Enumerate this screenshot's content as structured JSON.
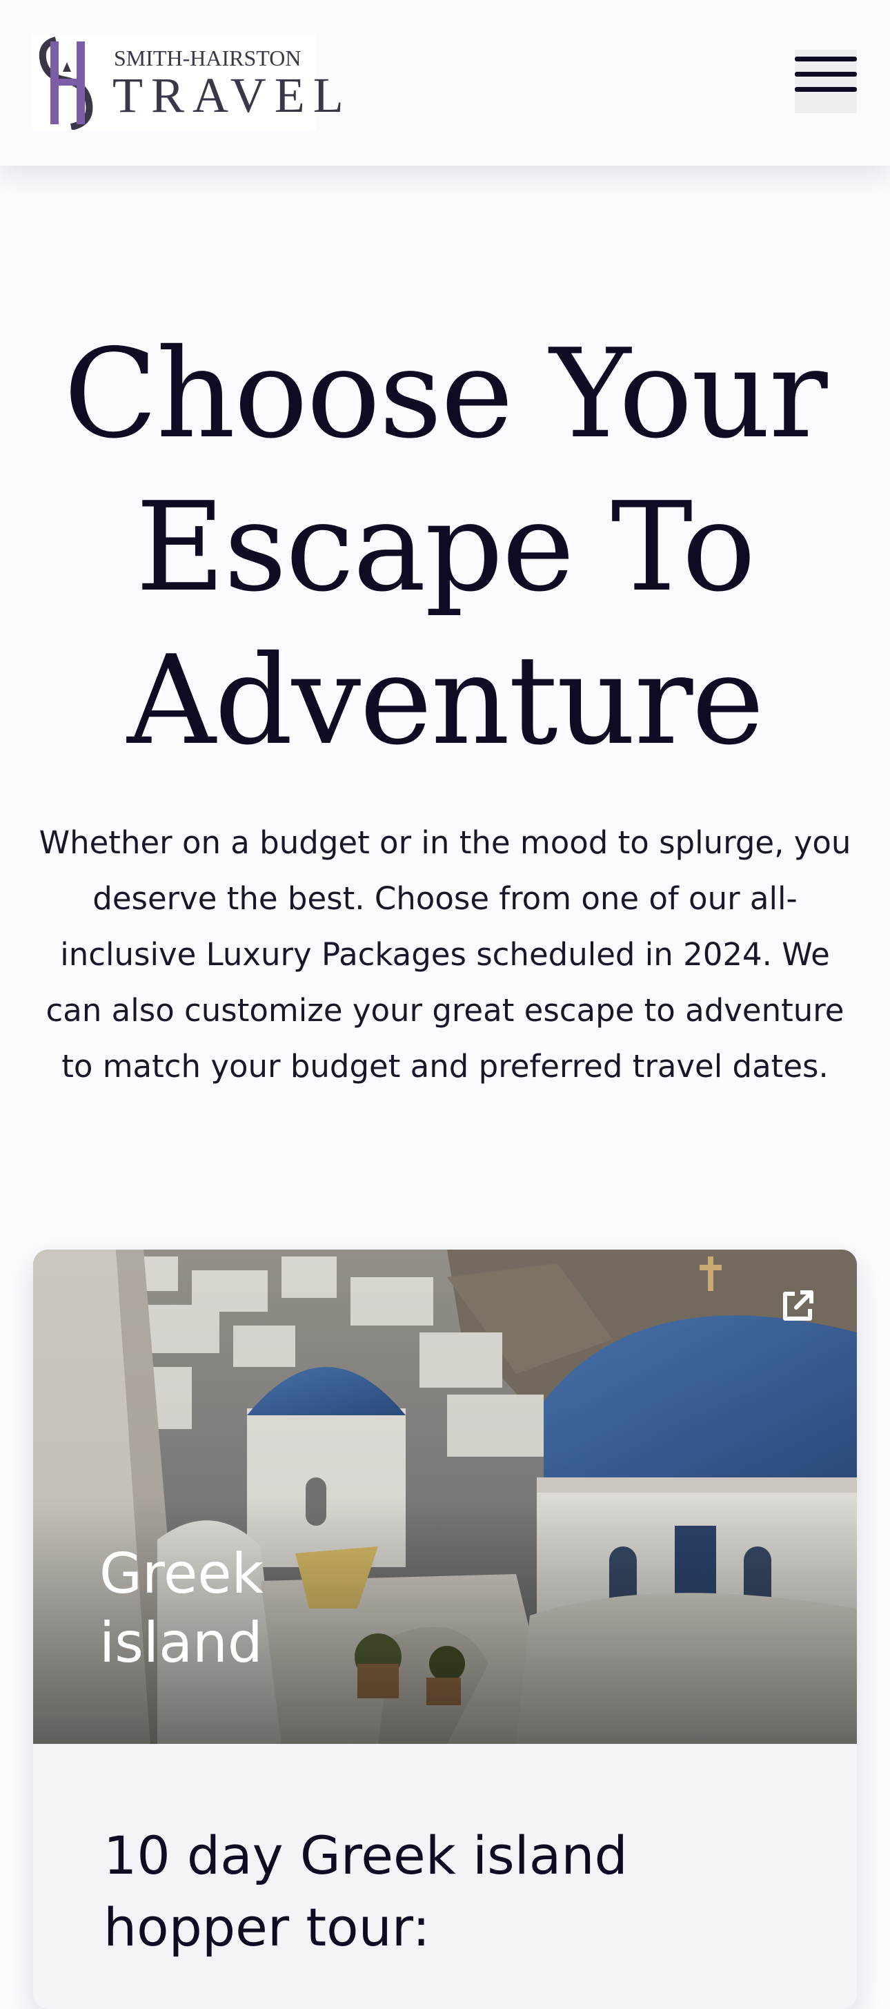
{
  "header": {
    "logo": {
      "line1": "SMITH-HAIRSTON",
      "line2": "TRAVEL",
      "monogram": "SH"
    },
    "menu_icon": "hamburger-menu-icon"
  },
  "hero": {
    "title_lines": [
      "Choose Your",
      "Escape To",
      "Adventure"
    ],
    "description": "Whether on a budget or in the mood to splurge, you deserve the best. Choose from one of our all-inclusive Luxury Packages scheduled in 2024. We can also customize your great escape to adventure to match your budget and preferred travel dates."
  },
  "card": {
    "label_line1": "Greek",
    "label_line2": "island",
    "title_line1": "10 day Greek island",
    "title_line2": "hopper tour:",
    "external_icon": "external-link-icon"
  },
  "colors": {
    "background": "#fbfafe",
    "text": "#0f0b22",
    "logo_purple": "#7b5ea7",
    "dome_blue": "#3f6aa8"
  }
}
